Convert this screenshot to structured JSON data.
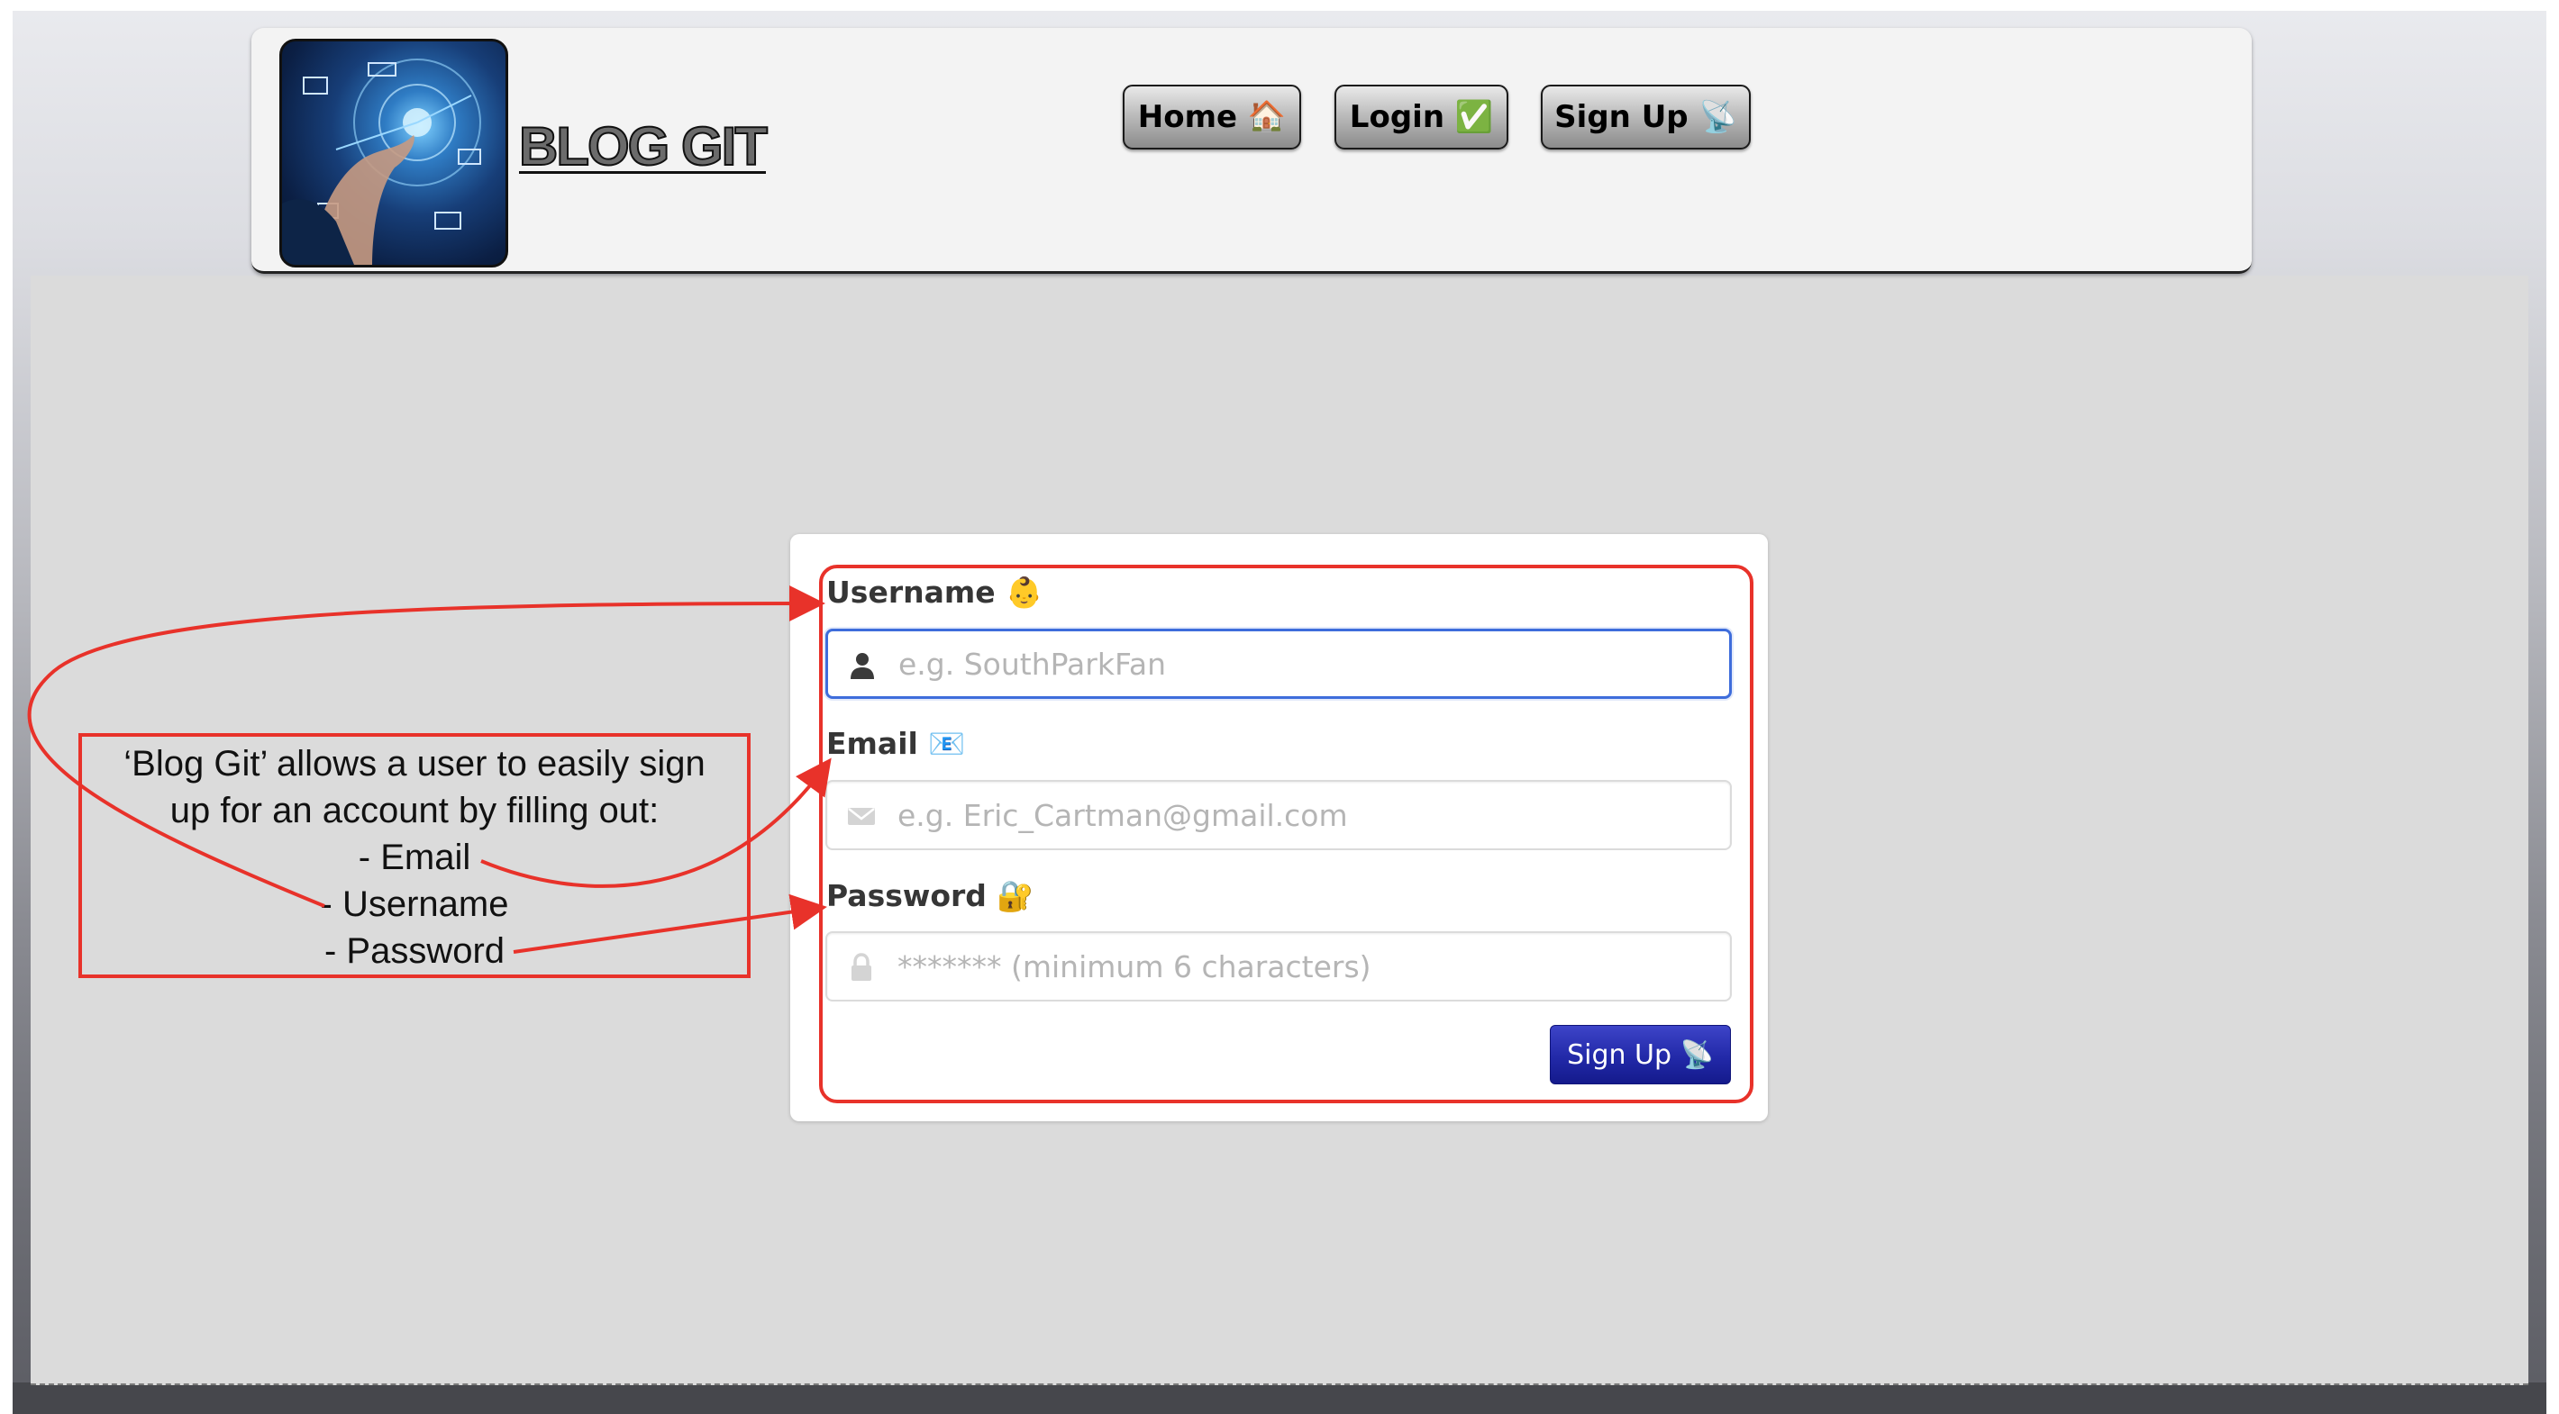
{
  "header": {
    "brand": "BLOG GIT",
    "nav": [
      {
        "label": "Home 🏠"
      },
      {
        "label": "Login ✅"
      },
      {
        "label": "Sign Up 📡"
      }
    ]
  },
  "form": {
    "username": {
      "label": "Username 👶",
      "placeholder": "e.g. SouthParkFan",
      "icon": "user-icon"
    },
    "email": {
      "label": "Email 📧",
      "placeholder": "e.g. Eric_Cartman@gmail.com",
      "icon": "envelope-icon"
    },
    "password": {
      "label": "Password 🔐",
      "placeholder": "******* (minimum 6 characters)",
      "icon": "lock-icon"
    },
    "submit_label": "Sign Up 📡"
  },
  "annotation": {
    "lines": [
      "‘Blog Git’ allows a user to easily sign",
      "up for an account by filling out:",
      "- Email",
      "- Username",
      "- Password"
    ],
    "color": "#e8322a"
  },
  "colors": {
    "primary_button": "#2229a8",
    "focus_border": "#3e6ddb"
  }
}
